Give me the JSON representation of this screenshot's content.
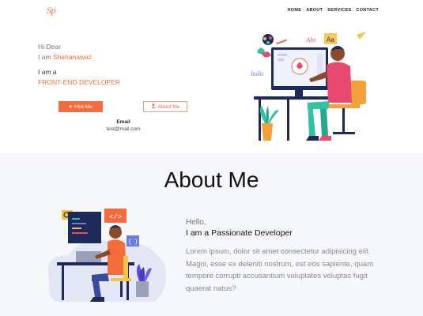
{
  "nav": {
    "logo": "Sp",
    "items": [
      "HOME",
      "ABOUT",
      "SERVICES",
      "CONTACT"
    ]
  },
  "hero": {
    "greeting": "Hi Dear",
    "intro_prefix": "I am ",
    "name": "Shahanawaz",
    "role_prefix": "I am a",
    "role": "FRONT-END DEVELOPER",
    "hire_label": "Hire Me",
    "about_label": "About Me",
    "email_label": "Email",
    "email": "test@mail.com",
    "illustration_words": [
      "Abc",
      "Aa",
      "Italic"
    ]
  },
  "about": {
    "title": "About Me",
    "hello": "Hello,",
    "tagline": "I am a Passionate Developer",
    "body": "Lorem ipsum, dolor sit amet consectetur adipisicing elit. Magni, esse ex deleniti nostrum, est eos sapiente, quam tempore corrupti accusantium voluptates voluptas fugit quaerat natus?",
    "illustration_code": "</>",
    "illustration_braces": "{ }"
  },
  "colors": {
    "accent": "#f26c3c",
    "section_bg": "#f6f7fa"
  },
  "icons": {
    "hire": "heart-icon",
    "about": "user-icon"
  }
}
